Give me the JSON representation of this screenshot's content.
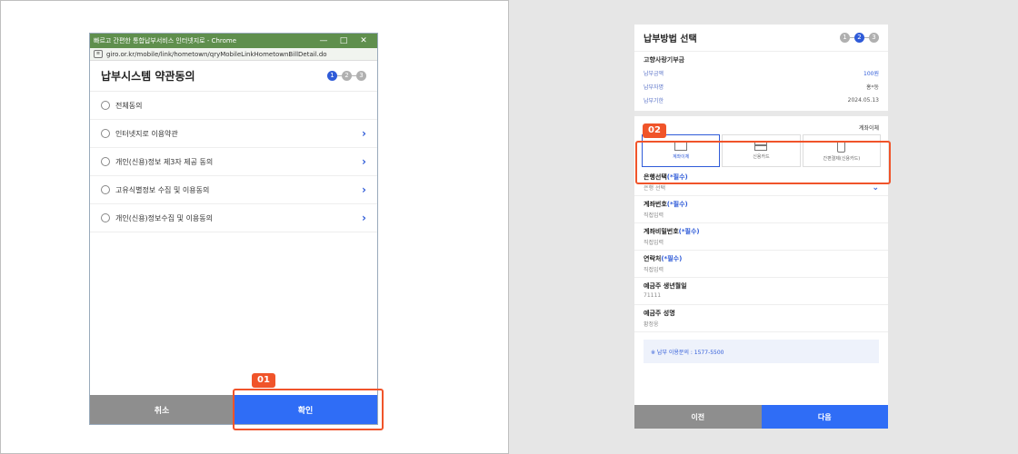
{
  "left": {
    "window_title": "빠르고 간편한 통합납부서비스 인터넷지로 - Chrome",
    "url": "giro.or.kr/mobile/link/hometown/qryMobileLinkHometownBillDetail.do",
    "terms_title": "납부시스템 약관동의",
    "steps": [
      "1",
      "2",
      "3"
    ],
    "items": [
      {
        "label": "전체동의"
      },
      {
        "label": "인터넷지로 이용약관"
      },
      {
        "label": "개인(신용)정보 제3자 제공 동의"
      },
      {
        "label": "고유식별정보 수집 및 이용동의"
      },
      {
        "label": "개인(신용)정보수집 및 이용동의"
      }
    ],
    "cancel_label": "취소",
    "confirm_label": "확인",
    "badge": "01"
  },
  "right": {
    "title": "납부방법 선택",
    "steps": [
      "1",
      "2",
      "3"
    ],
    "subtitle": "고향사랑기부금",
    "rows": [
      {
        "label": "납부금액",
        "value": "100원"
      },
      {
        "label": "납부자명",
        "value": "홍*동"
      },
      {
        "label": "납부기한",
        "value": "2024.05.13"
      }
    ],
    "method_selected": "계좌이체",
    "methods": [
      "계좌이체",
      "신용카드",
      "간편결제(신용카드)"
    ],
    "badge": "02",
    "fields": [
      {
        "title": "은행선택",
        "req": "(*필수)",
        "value": "은행 선택"
      },
      {
        "title": "계좌번호",
        "req": "(*필수)",
        "value": "직접입력"
      },
      {
        "title": "계좌비밀번호",
        "req": "(*필수)",
        "value": "직접입력"
      },
      {
        "title": "연락처",
        "req": "(*필수)",
        "value": "직접입력"
      },
      {
        "title": "예금주 생년월일",
        "req": "",
        "value": "71111"
      },
      {
        "title": "예금주 성명",
        "req": "",
        "value": "황정웅"
      }
    ],
    "info": "※ 납부 이용문의 : 1577-5500",
    "prev_label": "이전",
    "next_label": "다음"
  },
  "colors": {
    "accent": "#2f6df6",
    "highlight": "#f0542a",
    "gray_button": "#8e8e8e"
  }
}
